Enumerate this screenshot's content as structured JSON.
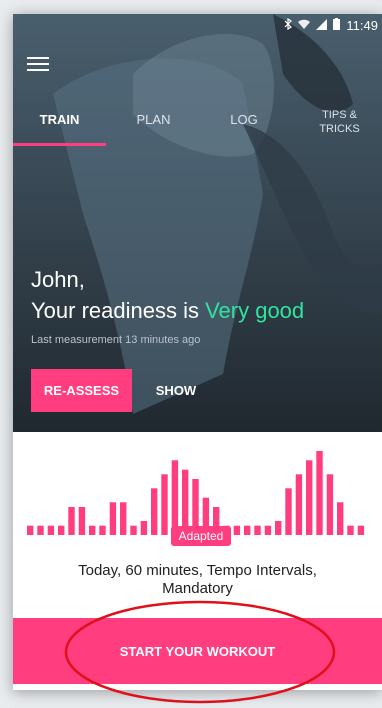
{
  "status_bar": {
    "time": "11:49",
    "icons": [
      "bluetooth-icon",
      "wifi-icon",
      "signal-icon",
      "battery-icon"
    ]
  },
  "nav": {
    "menu_icon": "hamburger-icon",
    "tabs": [
      {
        "label": "TRAIN",
        "active": true
      },
      {
        "label": "PLAN",
        "active": false
      },
      {
        "label": "LOG",
        "active": false
      },
      {
        "label_line1": "TIPS &",
        "label_line2": "TRICKS",
        "active": false
      }
    ]
  },
  "hero": {
    "greeting": "John,",
    "readiness_prefix": "Your readiness is ",
    "readiness_value": "Very good",
    "last_measurement": "Last measurement 13 minutes ago",
    "reassess_label": "RE-ASSESS",
    "show_label": "SHOW"
  },
  "chart_data": {
    "type": "bar",
    "values": [
      2,
      2,
      2,
      2,
      6,
      6,
      2,
      2,
      7,
      7,
      2,
      3,
      10,
      13,
      16,
      14,
      12,
      8,
      6,
      2,
      2,
      2,
      2,
      2,
      3,
      10,
      13,
      16,
      18,
      13,
      7,
      2,
      2
    ],
    "highlight_label": "Adapted",
    "color": "#ff3d7f"
  },
  "workout": {
    "description_line1": "Today, 60 minutes, Tempo Intervals,",
    "description_line2": "Mandatory",
    "start_label": "START YOUR WORKOUT"
  },
  "colors": {
    "accent": "#ff3d7f",
    "readiness": "#2ee59d",
    "annotation": "#e0101a"
  }
}
